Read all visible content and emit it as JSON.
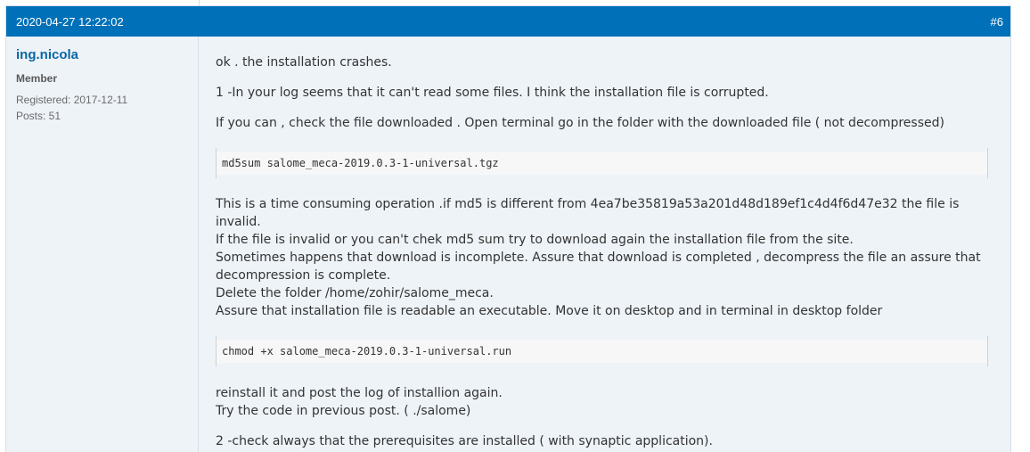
{
  "post": {
    "date": "2020-04-27 12:22:02",
    "number": "#6"
  },
  "user": {
    "name": "ing.nicola",
    "title": "Member",
    "registered": "Registered: 2017-12-11",
    "posts": "Posts: 51"
  },
  "content": {
    "p1": "ok . the installation crashes.",
    "p2": "1 -In your log seems that it can't read some files. I think the installation file is corrupted.",
    "p3": "If you can , check the file downloaded . Open terminal go in the folder with the downloaded file ( not decompressed)",
    "code1": "md5sum salome_meca-2019.0.3-1-universal.tgz",
    "p4_l1": "This is a time consuming operation .if md5 is different from 4ea7be35819a53a201d48d189ef1c4d4f6d47e32 the file is",
    "p4_l2": "invalid.",
    "p4_l3": "If the file is invalid or you can't chek md5 sum try to download again the installation file from the site.",
    "p4_l4": "Sometimes happens that download is incomplete. Assure that download is completed , decompress the file an assure that",
    "p4_l5": "decompression is complete.",
    "p4_l6": "Delete the folder /home/zohir/salome_meca.",
    "p4_l7": "Assure that installation file is readable an executable. Move it  on desktop and in terminal in desktop folder",
    "code2": "chmod +x salome_meca-2019.0.3-1-universal.run",
    "p5_l1": "reinstall it and post the log of installion again.",
    "p5_l2": "Try the code in previous post. ( ./salome)",
    "p6": "2 -check always that the prerequisites are installed ( with synaptic application)."
  }
}
